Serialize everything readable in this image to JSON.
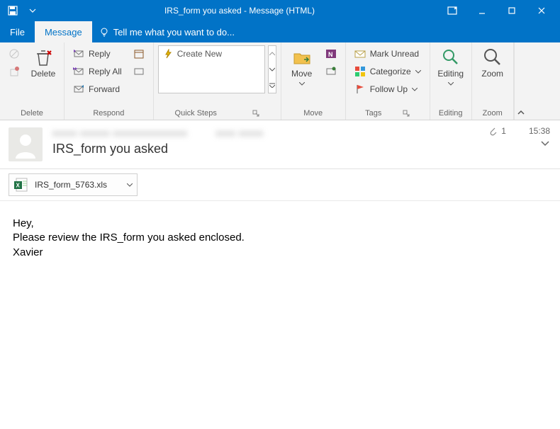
{
  "titlebar": {
    "title": "IRS_form you asked - Message (HTML)"
  },
  "tabs": {
    "file": "File",
    "message": "Message",
    "tellme": "Tell me what you want to do..."
  },
  "ribbon": {
    "delete": {
      "label": "Delete",
      "ignore": "",
      "junk": "",
      "group": "Delete"
    },
    "respond": {
      "reply": "Reply",
      "replyall": "Reply All",
      "forward": "Forward",
      "group": "Respond"
    },
    "quicksteps": {
      "create": "Create New",
      "group": "Quick Steps"
    },
    "move": {
      "move": "Move",
      "group": "Move"
    },
    "tags": {
      "unread": "Mark Unread",
      "categorize": "Categorize",
      "followup": "Follow Up",
      "group": "Tags"
    },
    "editing": {
      "label": "Editing",
      "group": "Editing"
    },
    "zoom": {
      "label": "Zoom",
      "group": "Zoom"
    }
  },
  "header": {
    "subject": "IRS_form you asked",
    "attachment_count": "1",
    "time": "15:38"
  },
  "attachment": {
    "name": "IRS_form_5763.xls"
  },
  "body": {
    "line1": "Hey,",
    "line2": "Please review the IRS_form you asked enclosed.",
    "line3": "Xavier"
  }
}
